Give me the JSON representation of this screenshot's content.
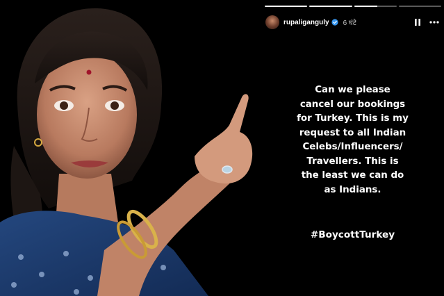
{
  "story": {
    "username": "rupaliganguly",
    "time": "6 घंटे",
    "progress": [
      1,
      1,
      0.55,
      0
    ],
    "text_lines": [
      "Can we please",
      "cancel our bookings",
      "for Turkey. This is my",
      "request to all Indian",
      "Celebs/Influencers/",
      "Travellers. This is",
      "the least we can do",
      "as Indians."
    ],
    "hashtag": "#BoycottTurkey"
  },
  "icons": {
    "verified": "verified-badge-icon",
    "pause": "pause-icon",
    "more": "more-options-icon"
  },
  "colors": {
    "background": "#000000",
    "text": "#ffffff",
    "verified": "#3897f0"
  }
}
